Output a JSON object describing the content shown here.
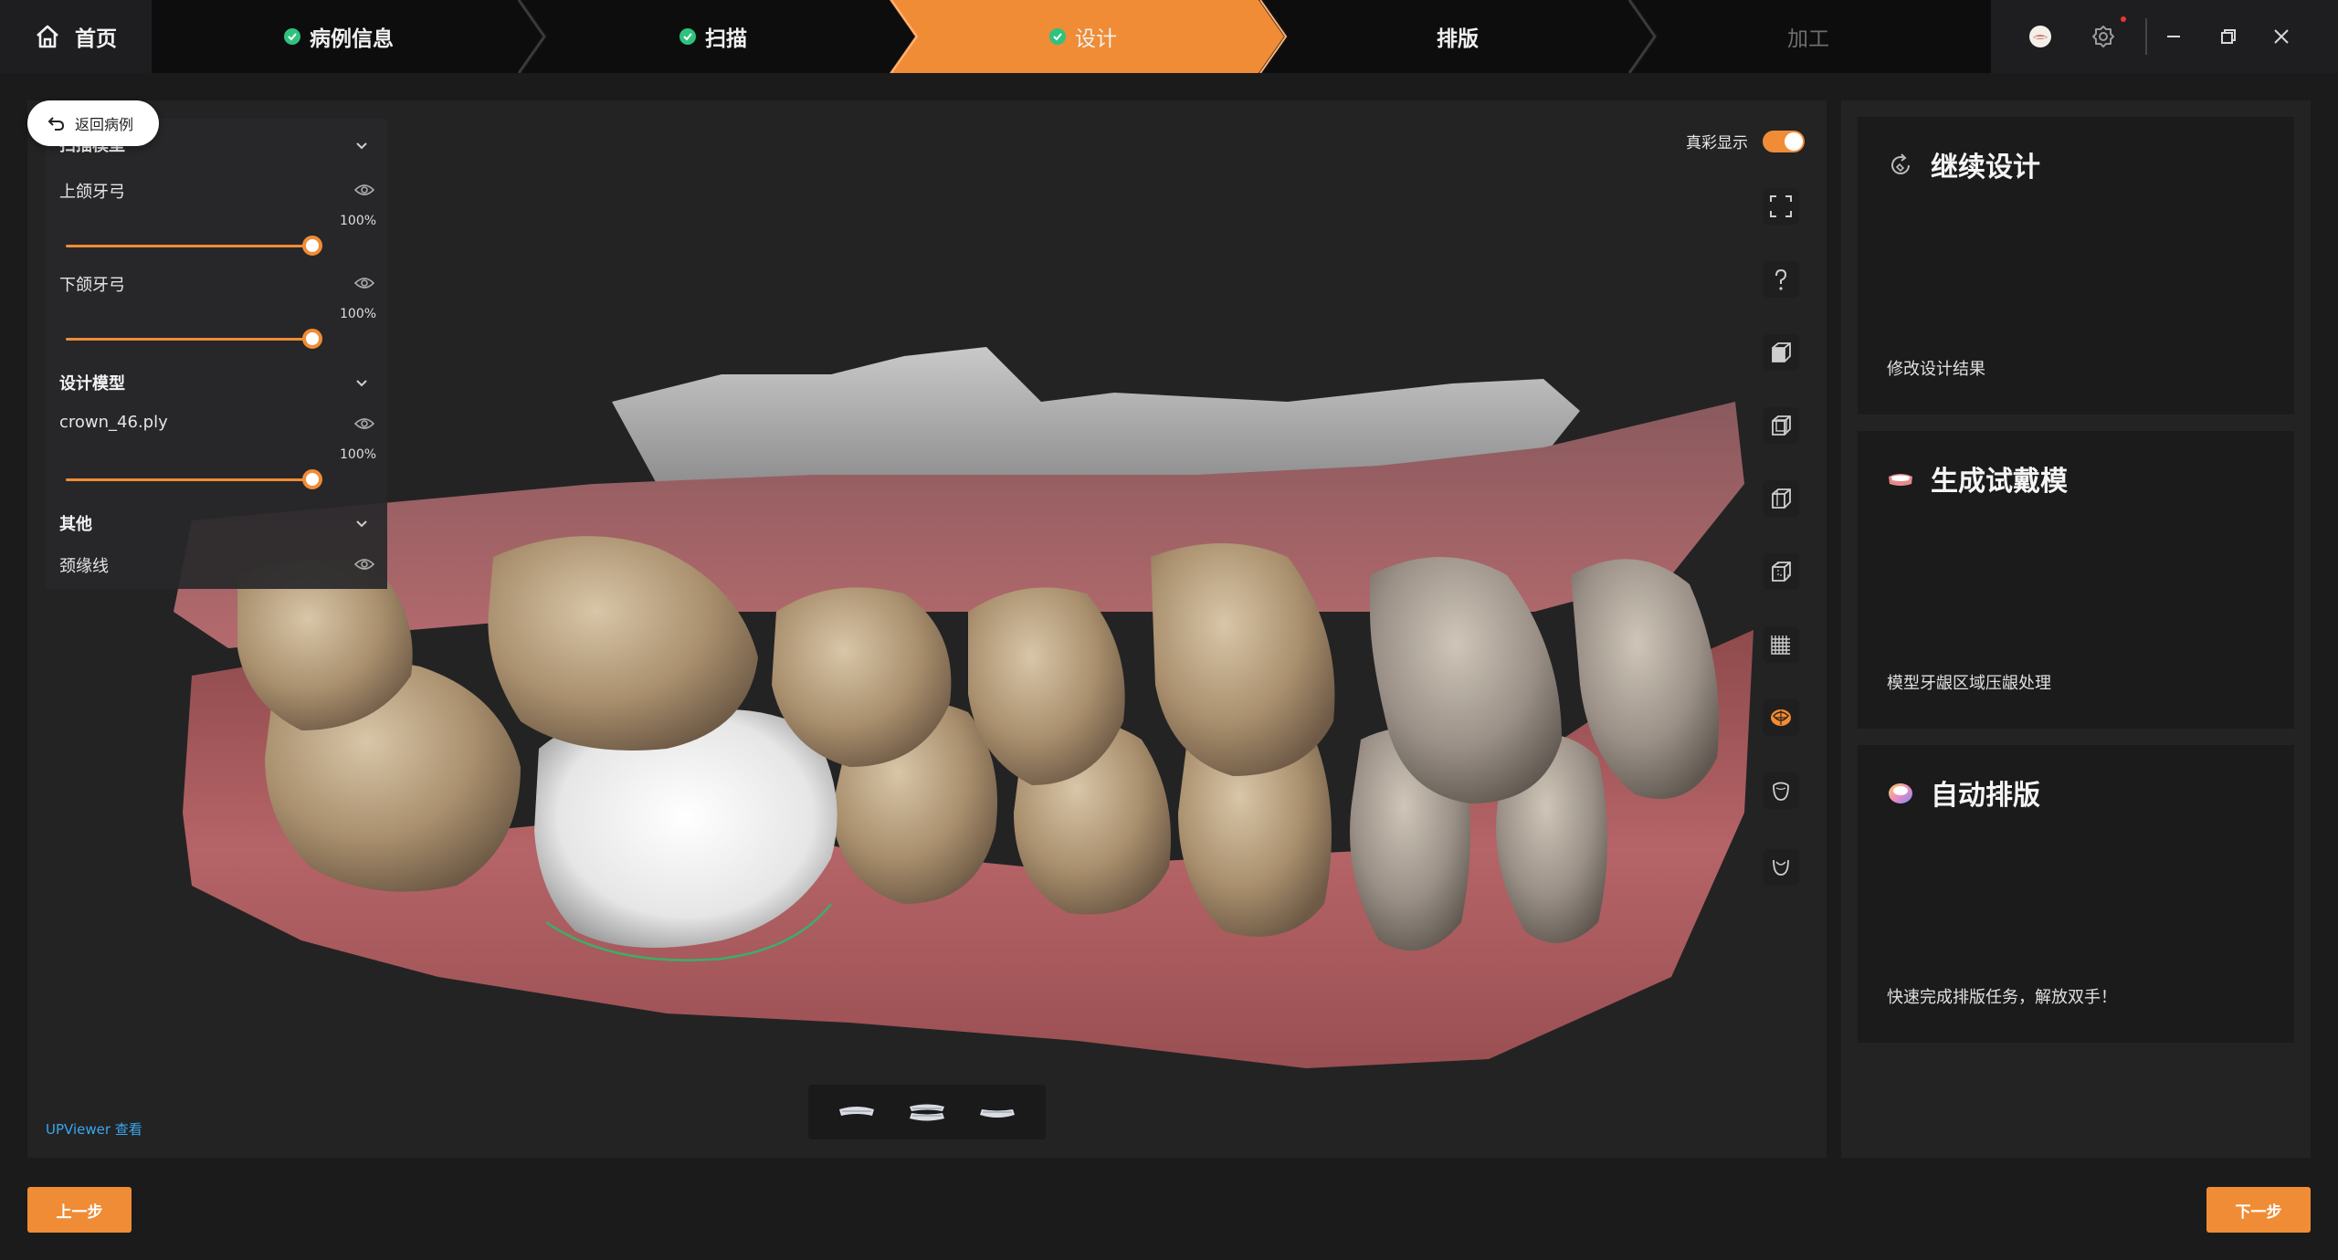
{
  "topbar": {
    "home_label": "首页",
    "steps": [
      {
        "label": "病例信息",
        "status": "done"
      },
      {
        "label": "扫描",
        "status": "done"
      },
      {
        "label": "设计",
        "status": "active"
      },
      {
        "label": "排版",
        "status": "pending"
      },
      {
        "label": "加工",
        "status": "disabled"
      }
    ],
    "icons": [
      "user-avatar-icon",
      "settings-icon",
      "minimize-icon",
      "restore-icon",
      "close-icon"
    ]
  },
  "colors": {
    "accent": "#f08c35",
    "done": "#2ec27e",
    "link": "#3aa6ee",
    "panel": "#232324",
    "background": "#1b1b1c"
  },
  "back_button": {
    "label": "返回病例"
  },
  "layers": {
    "scan_model": {
      "title": "扫描模型",
      "items": [
        {
          "name": "上颌牙弓",
          "opacity": "100%"
        },
        {
          "name": "下颌牙弓",
          "opacity": "100%"
        }
      ]
    },
    "design_model": {
      "title": "设计模型",
      "items": [
        {
          "name": "crown_46.ply",
          "opacity": "100%"
        }
      ]
    },
    "other": {
      "title": "其他",
      "items": [
        {
          "name": "颈缘线"
        }
      ]
    }
  },
  "viewer": {
    "true_color_label": "真彩显示",
    "true_color_on": true,
    "tools": [
      "fullscreen-icon",
      "help-icon",
      "front-view-cube-icon",
      "left-view-cube-icon",
      "right-view-cube-icon",
      "back-view-cube-icon",
      "grid-icon",
      "occlusion-map-icon",
      "upper-jaw-icon",
      "lower-jaw-icon"
    ],
    "view_buttons": [
      "upper-arch-view-icon",
      "both-arches-view-icon",
      "lower-arch-view-icon"
    ],
    "upviewer_label": "UPViewer 查看"
  },
  "cards": [
    {
      "title": "继续设计",
      "desc": "修改设计结果",
      "icon": "redesign-icon"
    },
    {
      "title": "生成试戴模",
      "desc": "模型牙龈区域压龈处理",
      "icon": "try-in-model-icon"
    },
    {
      "title": "自动排版",
      "desc": "快速完成排版任务，解放双手！",
      "icon": "auto-layout-icon"
    }
  ],
  "footer": {
    "prev_label": "上一步",
    "next_label": "下一步"
  }
}
